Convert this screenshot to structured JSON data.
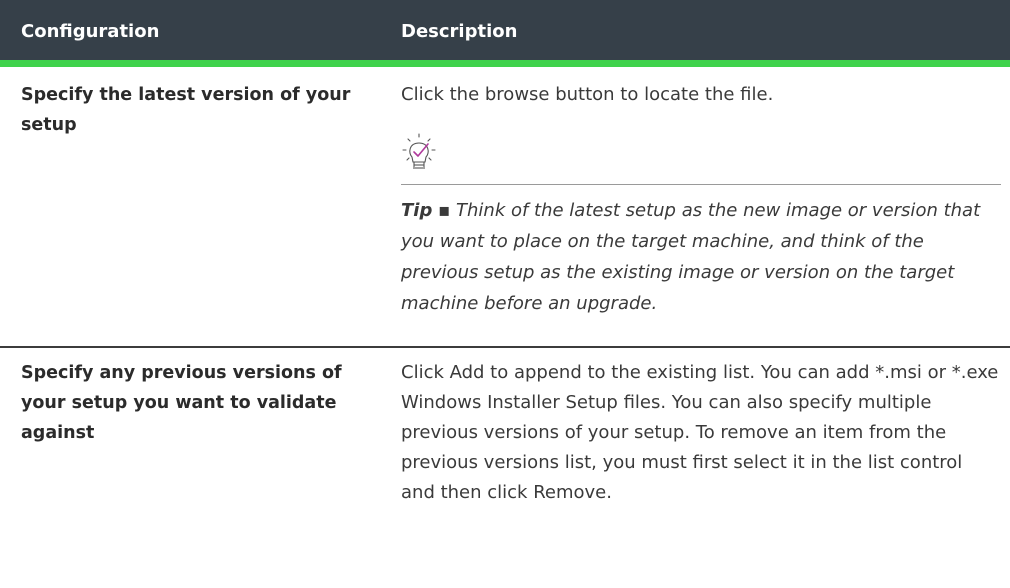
{
  "table": {
    "headers": {
      "configuration": "Configuration",
      "description": "Description"
    },
    "rows": [
      {
        "configuration": "Specify the latest version of your setup",
        "description": "Click the browse button to locate the file.",
        "tip": {
          "icon": "lightbulb-check-icon",
          "label": "Tip",
          "separator": "▪",
          "text": "Think of the latest setup as the new image or version that you want to place on the target machine, and think of the previous setup as the existing image or version on the target machine before an upgrade."
        }
      },
      {
        "configuration": "Specify any previous versions of your setup you want to validate against",
        "description": "Click Add to append to the existing list. You can add *.msi or *.exe Windows Installer Setup files. You can also specify multiple previous versions of your setup. To remove an item from the previous versions list, you must first select it in the list control and then click Remove."
      }
    ]
  },
  "colors": {
    "header_bg": "#364049",
    "header_accent": "#3fd24c",
    "icon_accent": "#b03a9c"
  }
}
